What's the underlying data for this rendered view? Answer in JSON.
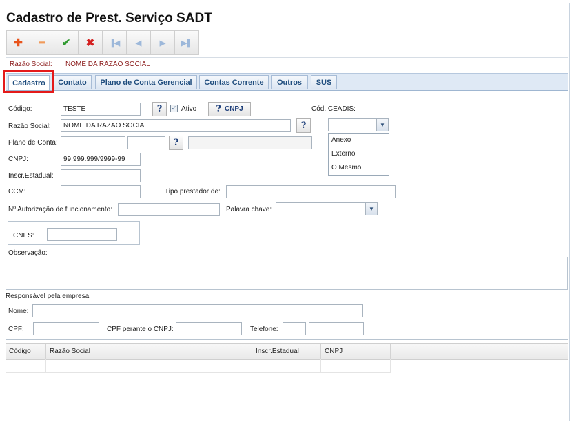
{
  "page": {
    "title": "Cadastro de Prest. Serviço SADT"
  },
  "toolbar": {
    "buttons": [
      {
        "name": "add",
        "glyph": "✚",
        "color": "#e8541c"
      },
      {
        "name": "remove",
        "glyph": "━",
        "color": "#f09a5a"
      },
      {
        "name": "confirm",
        "glyph": "✔",
        "color": "#2f9a2f"
      },
      {
        "name": "cancel",
        "glyph": "✖",
        "color": "#d42020"
      },
      {
        "name": "first",
        "glyph": "⏮",
        "color": "#9db8da"
      },
      {
        "name": "prev",
        "glyph": "◀",
        "color": "#9db8da"
      },
      {
        "name": "next",
        "glyph": "▶",
        "color": "#9db8da"
      },
      {
        "name": "last",
        "glyph": "⏭",
        "color": "#9db8da"
      }
    ]
  },
  "header": {
    "razao_label": "Razão Social:",
    "razao_value": "NOME DA RAZAO SOCIAL"
  },
  "tabs": [
    "Cadastro",
    "Contato",
    "Plano de Conta Gerencial",
    "Contas Corrente",
    "Outros",
    "SUS"
  ],
  "form": {
    "codigo_label": "Código:",
    "codigo_value": "TESTE",
    "ativo_label": "Ativo",
    "cnpj_button": "CNPJ",
    "ceadis_label": "Cód. CEADIS:",
    "ceadis_options": [
      "Anexo",
      "Externo",
      "O Mesmo"
    ],
    "razao_label": "Razão Social:",
    "razao_value": "NOME DA RAZAO SOCIAL",
    "plano_label": "Plano de Conta:",
    "cnpj_label": "CNPJ:",
    "cnpj_value": "99.999.999/9999-99",
    "inscr_label": "Inscr.Estadual:",
    "ccm_label": "CCM:",
    "tipo_label": "Tipo prestador de:",
    "autorizacao_label": "Nº Autorização de funcionamento:",
    "palavra_label": "Palavra chave:",
    "cnes_label": "CNES:",
    "obs_label": "Observação:"
  },
  "responsavel": {
    "section_label": "Responsável pela empresa",
    "nome_label": "Nome:",
    "cpf_label": "CPF:",
    "cpf_cnpj_label": "CPF perante o CNPJ:",
    "telefone_label": "Telefone:"
  },
  "grid": {
    "columns": [
      "Código",
      "Razão Social",
      "Inscr.Estadual",
      "CNPJ"
    ]
  }
}
